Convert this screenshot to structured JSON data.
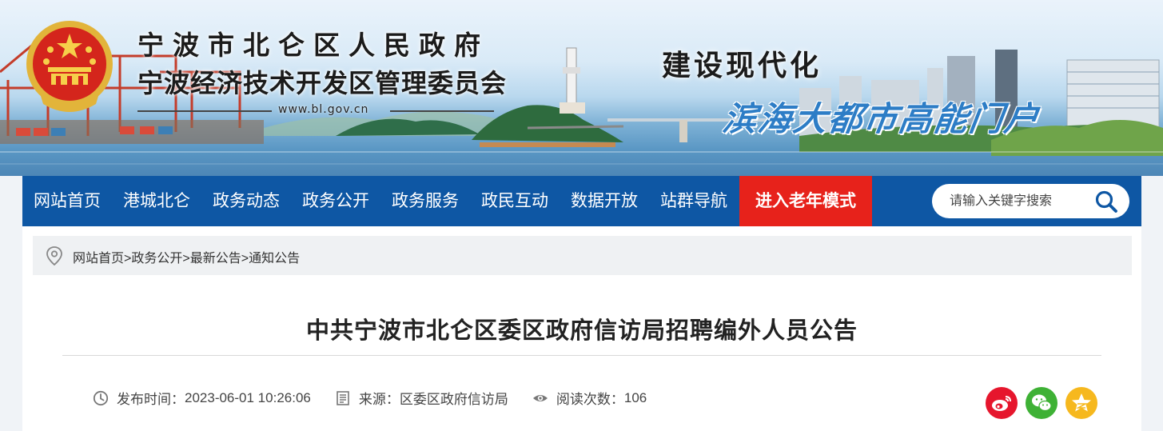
{
  "header": {
    "title": "宁波市北仑区人民政府",
    "subtitle": "宁波经济技术开发区管理委员会",
    "url": "www.bl.gov.cn",
    "slogan_1": "建设现代化",
    "slogan_2": "滨海大都市高能门户",
    "emblem": "national-emblem-icon"
  },
  "nav": {
    "items": [
      {
        "label": "网站首页"
      },
      {
        "label": "港城北仑"
      },
      {
        "label": "政务动态"
      },
      {
        "label": "政务公开"
      },
      {
        "label": "政务服务"
      },
      {
        "label": "政民互动"
      },
      {
        "label": "数据开放"
      },
      {
        "label": "站群导航"
      }
    ],
    "senior_mode": "进入老年模式",
    "search_placeholder": "请输入关键字搜索",
    "colors": {
      "nav_bg": "#0e57a4",
      "senior_bg": "#e7221b"
    }
  },
  "breadcrumb": {
    "items": [
      "网站首页",
      "政务公开",
      "最新公告",
      "通知公告"
    ],
    "separator": ">"
  },
  "article": {
    "title": "中共宁波市北仑区委区政府信访局招聘编外人员公告",
    "publish_label": "发布时间：",
    "publish_time": "2023-06-01 10:26:06",
    "source_label": "来源：",
    "source": "区委区政府信访局",
    "views_label": "阅读次数：",
    "views": "106"
  },
  "share": {
    "buttons": [
      {
        "icon": "weibo-icon",
        "color": "#e6162d"
      },
      {
        "icon": "wechat-icon",
        "color": "#3eb135"
      },
      {
        "icon": "qzone-star-icon",
        "color": "#f6b81e"
      }
    ]
  }
}
